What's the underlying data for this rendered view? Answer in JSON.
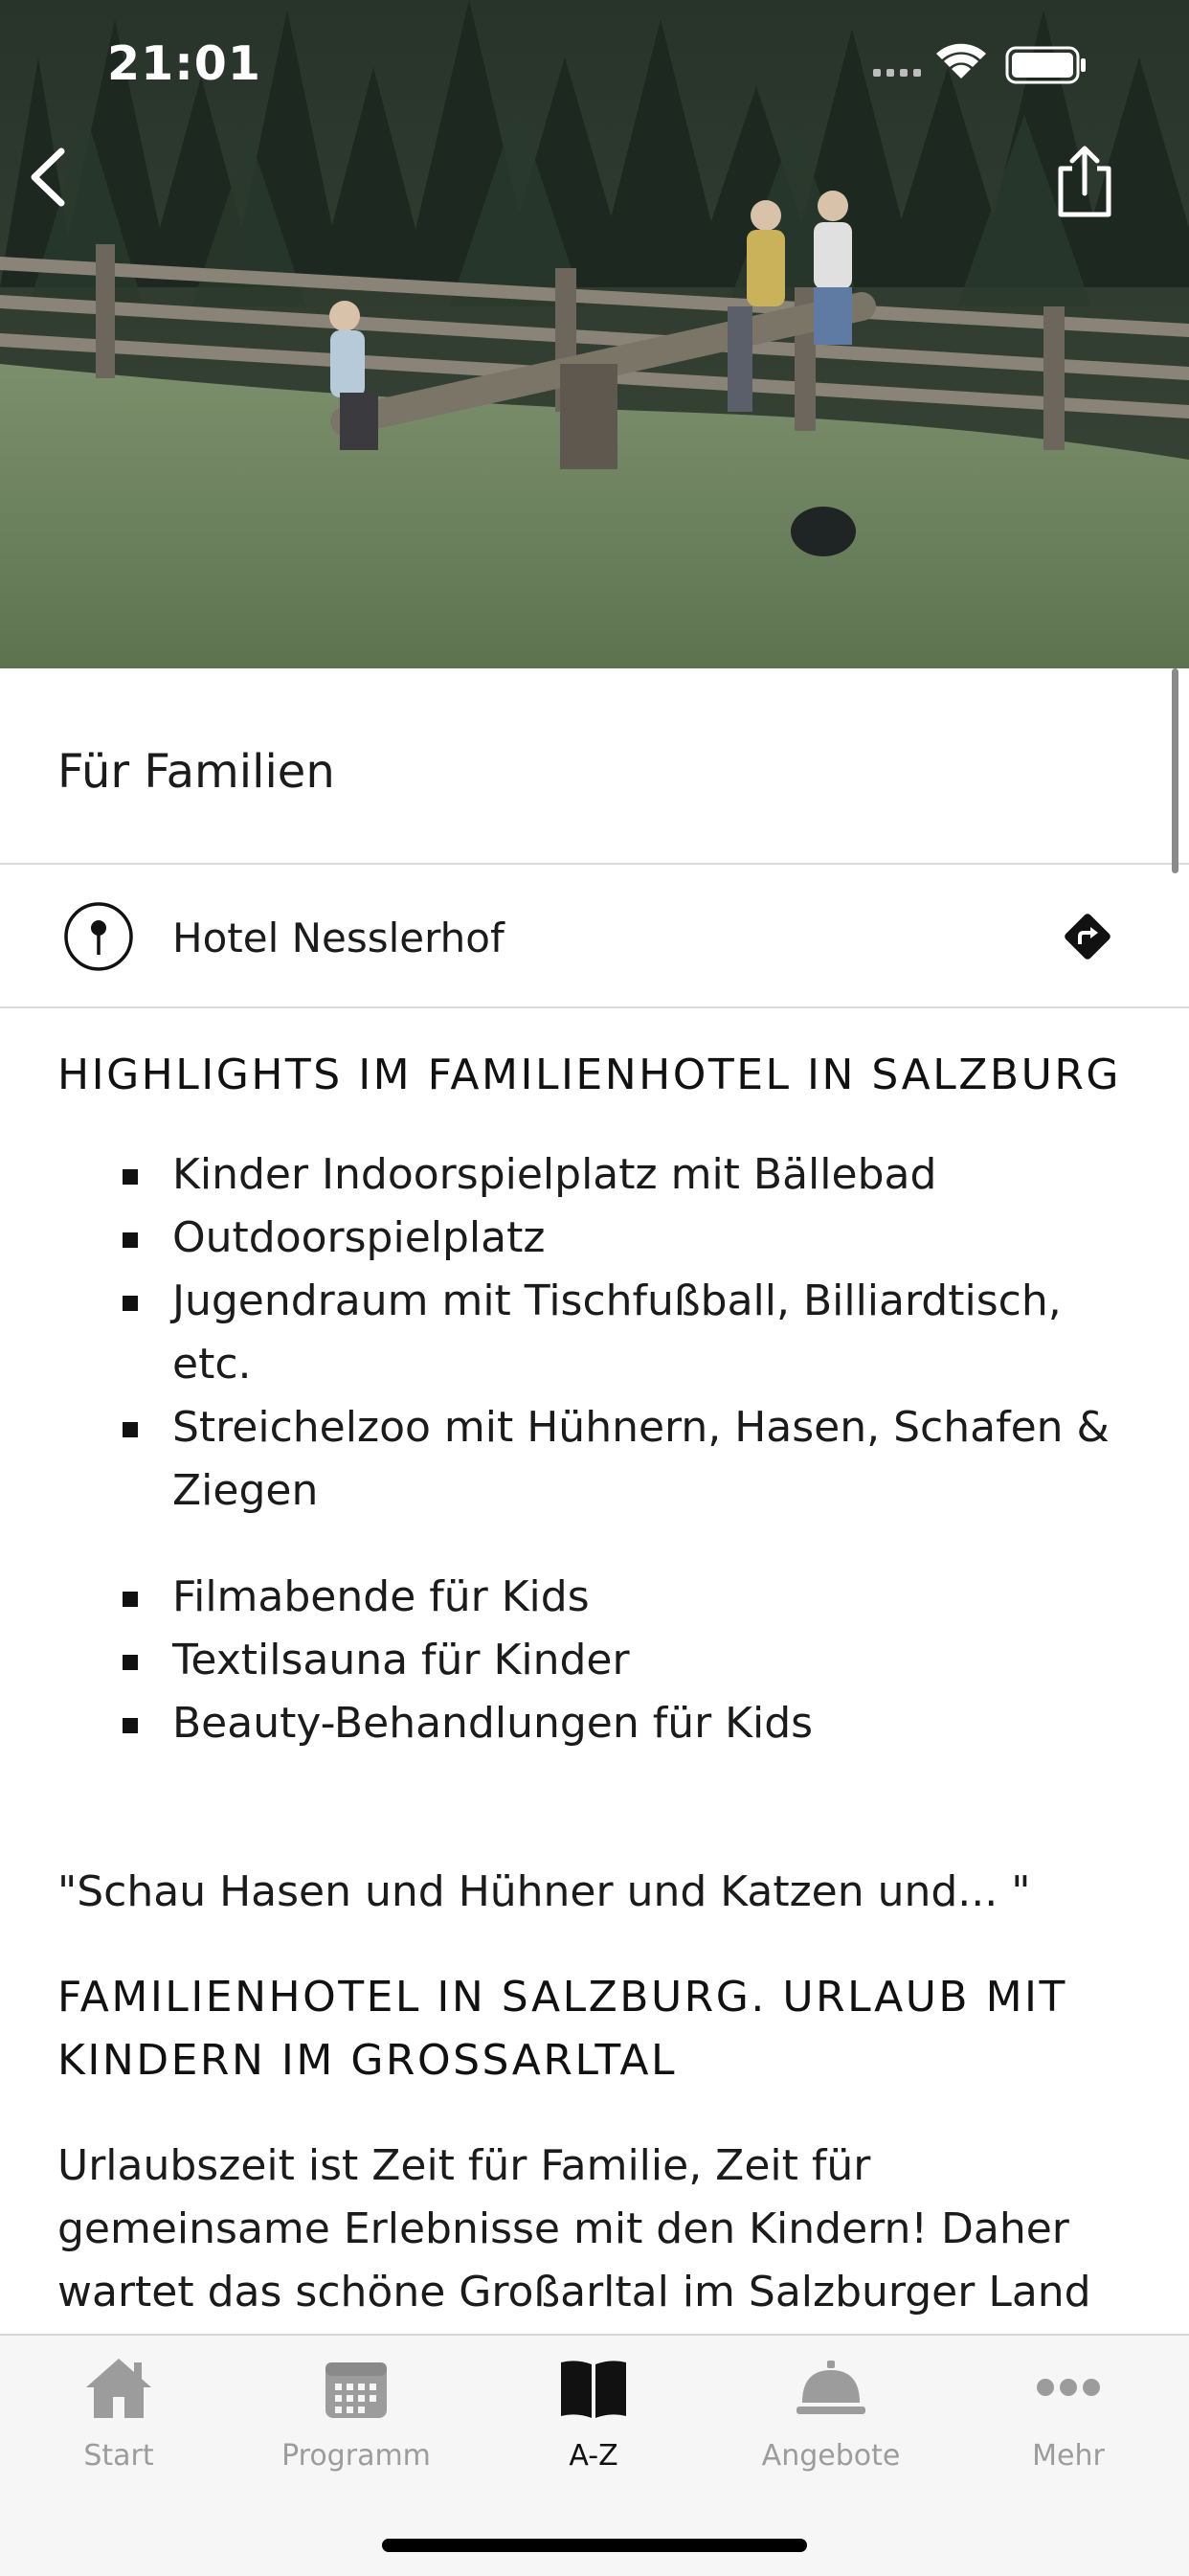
{
  "status_bar": {
    "time": "21:01"
  },
  "hero": {
    "image_description_icon": "family-playground-photo"
  },
  "page": {
    "title": "Für Familien"
  },
  "location": {
    "name": "Hotel Nesslerhof"
  },
  "highlights": {
    "heading": "HIGHLIGHTS IM FAMILIENHOTEL IN SALZBURG",
    "list_1": [
      "Kinder Indoorspielplatz mit Bällebad",
      "Outdoorspielplatz",
      "Jugendraum mit Tischfußball, Billiardtisch, etc.",
      "Streichelzoo mit Hühnern, Hasen, Schafen & Ziegen"
    ],
    "list_2": [
      "Filmabende für Kids",
      "Textilsauna für Kinder",
      "Beauty-Behandlungen für Kids"
    ]
  },
  "quote": "\"Schau Hasen und Hühner und Katzen und... \"",
  "section2": {
    "heading": "FAMILIENHOTEL IN SALZBURG. URLAUB MIT KINDERN IM GROSSARLTAL",
    "body": "Urlaubszeit ist Zeit für Familie, Zeit für gemeinsame Erlebnisse mit den Kindern! Daher wartet das schöne Großarltal im Salzburger Land mit zahlreichen Spielplätzen, Wandermöglichkeiten und Ausflugzielen"
  },
  "tabbar": {
    "tabs": [
      {
        "label": "Start",
        "icon": "home-icon",
        "active": false
      },
      {
        "label": "Programm",
        "icon": "calendar-icon",
        "active": false
      },
      {
        "label": "A-Z",
        "icon": "book-icon",
        "active": true
      },
      {
        "label": "Angebote",
        "icon": "service-bell-icon",
        "active": false
      },
      {
        "label": "Mehr",
        "icon": "more-dots-icon",
        "active": false
      }
    ]
  },
  "colors": {
    "active_tab": "#111111",
    "inactive_tab": "#9c9c9c",
    "divider": "#dcdcdc",
    "tabbar_bg": "#f6f6f6"
  }
}
